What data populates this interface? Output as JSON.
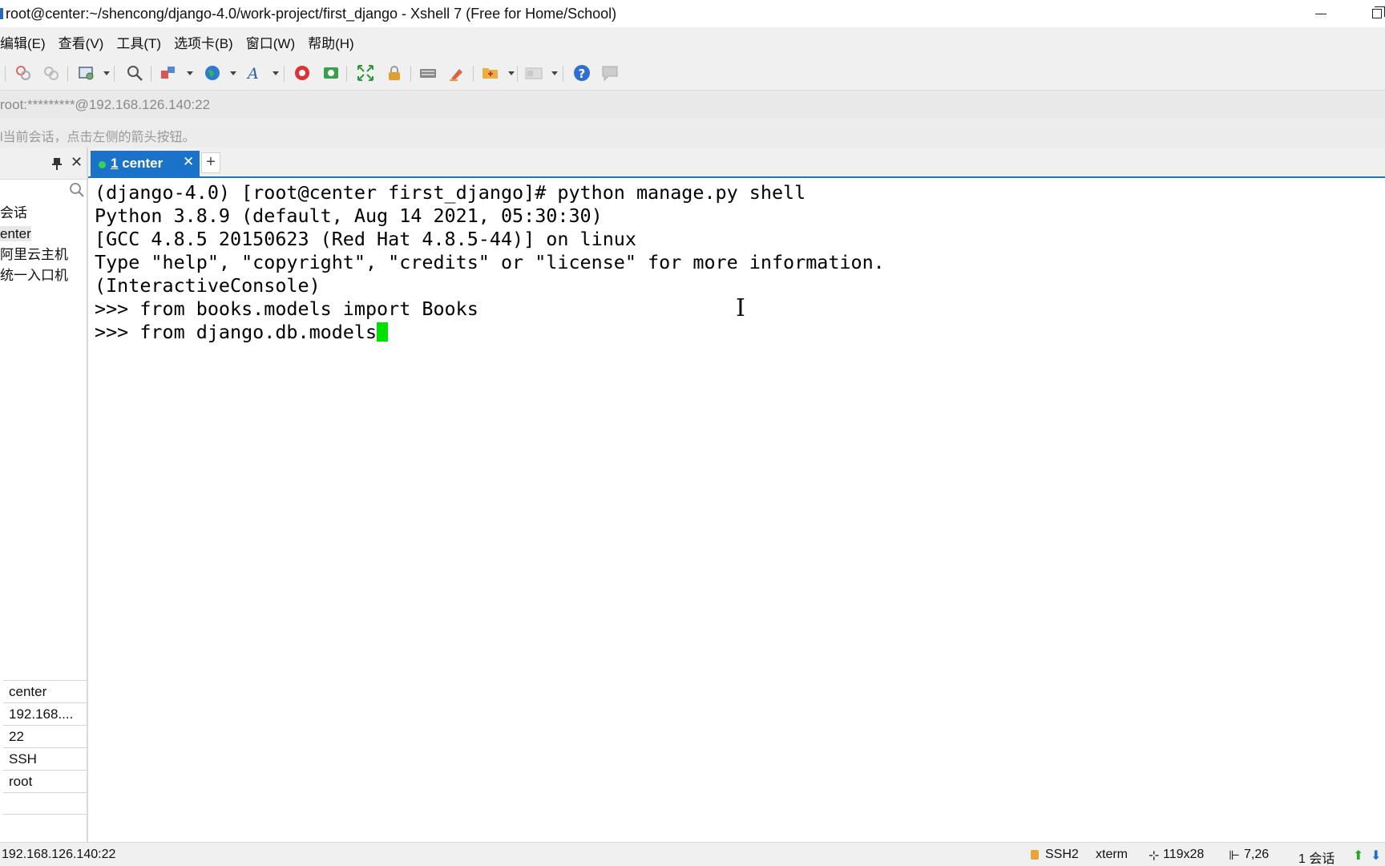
{
  "window": {
    "title": "root@center:~/shencong/django-4.0/work-project/first_django - Xshell 7 (Free for Home/School)"
  },
  "menu": [
    {
      "label": "编辑(E)"
    },
    {
      "label": "查看(V)"
    },
    {
      "label": "工具(T)"
    },
    {
      "label": "选项卡(B)"
    },
    {
      "label": "窗口(W)"
    },
    {
      "label": "帮助(H)"
    }
  ],
  "toolbar": {
    "icons": [
      "disconnect-icon",
      "reconnect-icon",
      "session-properties-icon",
      "find-icon",
      "layout-icon",
      "globe-icon",
      "font-icon",
      "xftp-icon",
      "xmanager-icon",
      "fullscreen-icon",
      "lock-icon",
      "keyboard-icon",
      "highlight-icon",
      "new-folder-icon",
      "compose-pane-icon",
      "help-icon",
      "chat-icon"
    ]
  },
  "address": {
    "value": "root:*********@192.168.126.140:22"
  },
  "hint": {
    "text": "l当前会话，点击左侧的箭头按钮。"
  },
  "sidebar": {
    "tree": [
      {
        "label": "会话"
      },
      {
        "label": "enter"
      },
      {
        "label": "阿里云主机"
      },
      {
        "label": "统一入口机"
      }
    ],
    "properties": [
      {
        "value": "center"
      },
      {
        "value": "192.168...."
      },
      {
        "value": "22"
      },
      {
        "value": "SSH"
      },
      {
        "value": "root"
      },
      {
        "value": ""
      }
    ]
  },
  "tabs": [
    {
      "number": "1",
      "name": "center",
      "status_color": "#39d353"
    }
  ],
  "terminal": {
    "lines": [
      "(django-4.0) [root@center first_django]# python manage.py shell",
      "Python 3.8.9 (default, Aug 14 2021, 05:30:30)",
      "[GCC 4.8.5 20150623 (Red Hat 4.8.5-44)] on linux",
      "Type \"help\", \"copyright\", \"credits\" or \"license\" for more information.",
      "(InteractiveConsole)",
      ">>> from books.models import Books",
      ">>> from django.db.models"
    ],
    "cursor_color": "#00e000"
  },
  "status": {
    "host": "192.168.126.140:22",
    "protocol": "SSH2",
    "term": "xterm",
    "size": "119x28",
    "position": "7,26",
    "sessions": "1 会话"
  },
  "colors": {
    "tab_active": "#1a73c8",
    "terminal_bg": "#ffffff"
  }
}
